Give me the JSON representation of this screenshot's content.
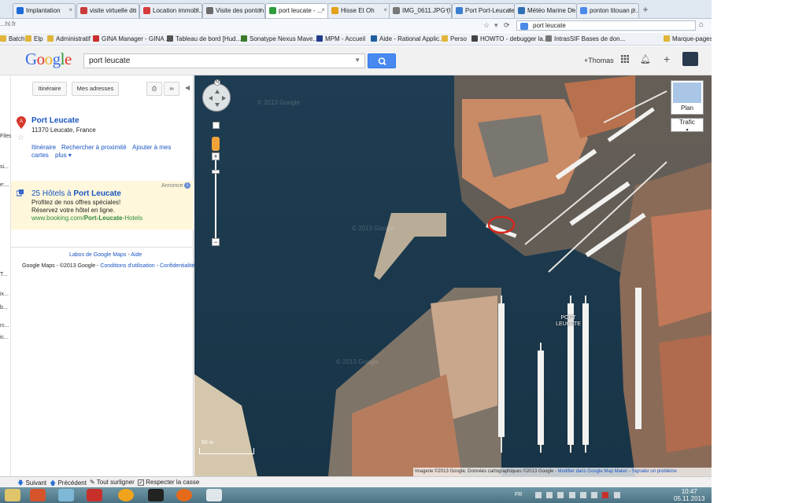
{
  "browser": {
    "tabs": [
      {
        "label": "Implantation",
        "color": "#1e6ad6"
      },
      {
        "label": "visite virtuelle du ...",
        "color": "#c73b3b"
      },
      {
        "label": "Location immobi...",
        "color": "#d63c3c"
      },
      {
        "label": "Visite des ponton...",
        "color": "#6b6b6b"
      },
      {
        "label": "port leucate - ...",
        "color": "#2d9c3a"
      },
      {
        "label": "Hisse Et Oh",
        "color": "#e3a21a"
      },
      {
        "label": "IMG_0611.JPG (I...",
        "color": "#777777"
      },
      {
        "label": "Port Port-Leucate...",
        "color": "#3a7fd0"
      },
      {
        "label": "Météo Marine De...",
        "color": "#2f6fb6"
      },
      {
        "label": "ponton titouan p...",
        "color": "#4a8ae8"
      }
    ],
    "new_tab_label": "+",
    "url_text": "...hl.fr",
    "search_value": "port leucate",
    "bookmarks": [
      {
        "label": "Batch",
        "color": "#e0b53a"
      },
      {
        "label": "Elp",
        "color": "#e0b53a"
      },
      {
        "label": "Administratif",
        "color": "#e0b53a"
      },
      {
        "label": "GINA Manager - GINA ...",
        "color": "#c9302c"
      },
      {
        "label": "Tableau de bord [Hud...",
        "color": "#555555"
      },
      {
        "label": "Sonatype Nexus Mave...",
        "color": "#3b7a2a"
      },
      {
        "label": "MPM - Accueil",
        "color": "#223a8a"
      },
      {
        "label": "Aide - Rational Applic...",
        "color": "#1f5f9f"
      },
      {
        "label": "Perso",
        "color": "#e0b53a"
      },
      {
        "label": "HOWTO - debugger la...",
        "color": "#444444"
      },
      {
        "label": "IntrasSIF Bases de don...",
        "color": "#777777"
      },
      {
        "label": "Marque-pages",
        "color": "#e0b53a"
      }
    ]
  },
  "maps": {
    "logo": "Google",
    "query": "port leucate",
    "user": "+Thomas",
    "sidebar": {
      "btn_itinerary": "Itinéraire",
      "btn_my_addresses": "Mes adresses",
      "result": {
        "marker": "A",
        "title": "Port Leucate",
        "address": "11370 Leucate, France",
        "links": [
          "Itinéraire",
          "Rechercher à proximité",
          "Ajouter à mes",
          "cartes",
          "plus"
        ]
      },
      "ad": {
        "label": "Annonce",
        "title_prefix": "25 Hôtels à ",
        "title_bold": "Port Leucate",
        "line1": "Profitez de nos offres spéciales!",
        "line2": "Réservez votre hôtel en ligne.",
        "url_prefix": "www.booking.com/",
        "url_bold": "Port-Leucate",
        "url_suffix": "-Hotels"
      },
      "footer": {
        "labs": "Labos de Google Maps",
        "sep": " - ",
        "help": "Aide",
        "copyright": "Google Maps - ©2013 Google - ",
        "terms": "Conditions d'utilisation",
        "privacy": "Confidentialité"
      }
    },
    "map": {
      "north_label": "N",
      "layer_plan": "Plan",
      "layer_traffic": "Trafic",
      "place_label": "PORT LEUCATE",
      "scale": "50 m",
      "watermark": "© 2013 Google",
      "attribution": "Imagerie ©2013 Google, Données cartographiques ©2013 Google - ",
      "edit_link": "Modifier dans Google Map Maker",
      "report_link": "Signaler un problème",
      "highlight_color": "#d8261c"
    },
    "findbar": {
      "next": "Suivant",
      "prev": "Précédent",
      "highlight": "Tout surligner",
      "match_case": "Respecter la casse"
    },
    "taskbar": {
      "lang": "FR",
      "time": "10:47",
      "date": "05.11.2013"
    },
    "left_clip": [
      "Files",
      "si...",
      "e:...",
      "T...",
      "ix...",
      "b...",
      "rc...",
      "ic..."
    ]
  }
}
